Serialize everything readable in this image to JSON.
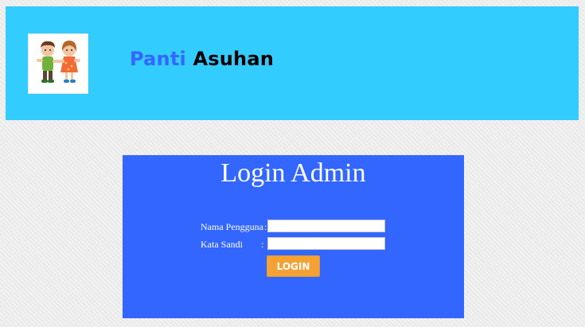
{
  "header": {
    "title_part1": "Panti",
    "title_part2": "Asuhan",
    "logo": "children-logo-icon",
    "background_color": "#33ccff"
  },
  "login": {
    "title": "Login Admin",
    "username_label": "Nama Pengguna",
    "username_colon": ":",
    "username_value": "",
    "password_label": "Kata Sandi",
    "password_colon": ":",
    "password_value": "",
    "button_label": "LOGIN",
    "box_color": "#3366ff",
    "button_color": "#f4a235"
  }
}
